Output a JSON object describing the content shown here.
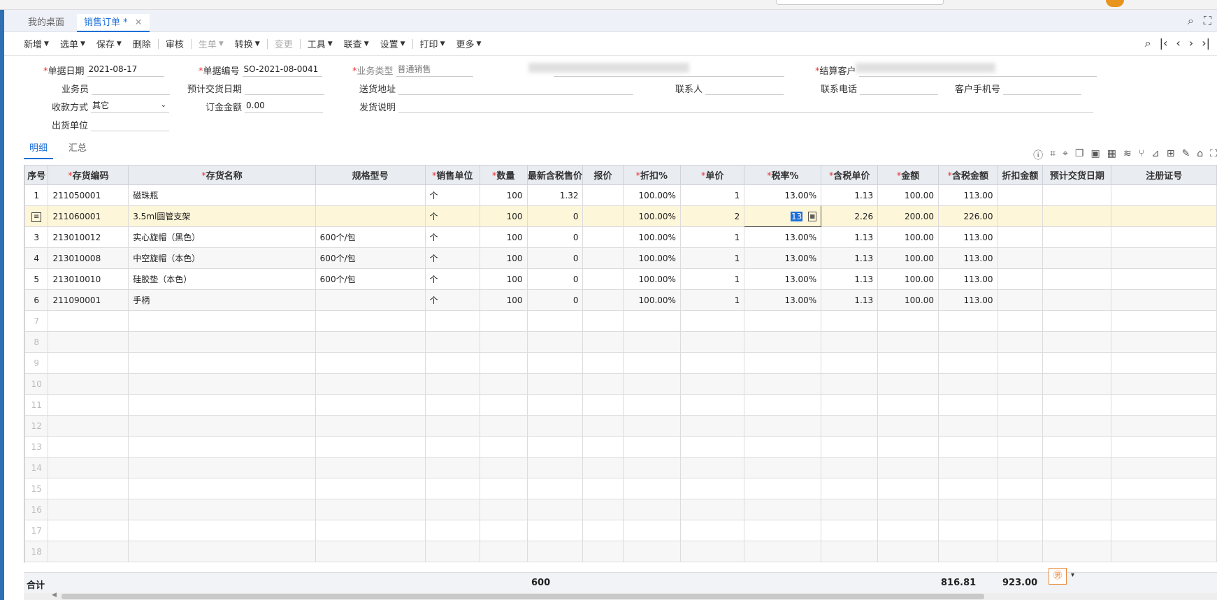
{
  "tabs": [
    {
      "label": "我的桌面",
      "active": false
    },
    {
      "label": "销售订单 *",
      "active": true
    }
  ],
  "toolbar": {
    "items": [
      "新增",
      "选单",
      "保存",
      "删除",
      "审核",
      "生单",
      "转换",
      "变更",
      "工具",
      "联查",
      "设置",
      "打印",
      "更多"
    ]
  },
  "form": {
    "doc_date_label": "单据日期",
    "doc_date": "2021-08-17",
    "doc_no_label": "单据编号",
    "doc_no": "SO-2021-08-0041",
    "biz_type_label": "业务类型",
    "biz_type": "普通销售",
    "settle_customer_label": "结算客户",
    "salesman_label": "业务员",
    "expected_date_label": "预计交货日期",
    "ship_addr_label": "送货地址",
    "contact_label": "联系人",
    "phone_label": "联系电话",
    "mobile_label": "客户手机号",
    "payment_label": "收款方式",
    "payment": "其它",
    "deposit_label": "订金金额",
    "deposit": "0.00",
    "ship_note_label": "发货说明",
    "ship_unit_label": "出货单位"
  },
  "subtabs": [
    "明细",
    "汇总"
  ],
  "grid": {
    "headers": [
      "序号",
      "存货编码",
      "存货名称",
      "规格型号",
      "销售单位",
      "数量",
      "最新含税售价",
      "报价",
      "折扣%",
      "单价",
      "税率%",
      "含税单价",
      "金额",
      "含税金额",
      "折扣金额",
      "预计交货日期",
      "注册证号"
    ],
    "required": [
      false,
      true,
      true,
      false,
      true,
      true,
      false,
      false,
      true,
      true,
      true,
      true,
      true,
      true,
      false,
      false,
      false
    ],
    "rows": [
      {
        "idx": "1",
        "code": "211050001",
        "name": "磁珠瓶",
        "spec": "",
        "unit": "个",
        "qty": "100",
        "latest": "1.32",
        "quote": "",
        "disc": "100.00%",
        "price": "1",
        "tax": "13.00%",
        "taxprice": "1.13",
        "amount": "100.00",
        "taxamount": "113.00"
      },
      {
        "idx": "",
        "code": "211060001",
        "name": "3.5ml圆管支架",
        "spec": "",
        "unit": "个",
        "qty": "100",
        "latest": "0",
        "quote": "",
        "disc": "100.00%",
        "price": "2",
        "tax": "13",
        "taxprice": "2.26",
        "amount": "200.00",
        "taxamount": "226.00"
      },
      {
        "idx": "3",
        "code": "213010012",
        "name": "实心旋帽（黑色）",
        "spec": "600个/包",
        "unit": "个",
        "qty": "100",
        "latest": "0",
        "quote": "",
        "disc": "100.00%",
        "price": "1",
        "tax": "13.00%",
        "taxprice": "1.13",
        "amount": "100.00",
        "taxamount": "113.00"
      },
      {
        "idx": "4",
        "code": "213010008",
        "name": "中空旋帽（本色）",
        "spec": "600个/包",
        "unit": "个",
        "qty": "100",
        "latest": "0",
        "quote": "",
        "disc": "100.00%",
        "price": "1",
        "tax": "13.00%",
        "taxprice": "1.13",
        "amount": "100.00",
        "taxamount": "113.00"
      },
      {
        "idx": "5",
        "code": "213010010",
        "name": "硅胶垫（本色）",
        "spec": "600个/包",
        "unit": "个",
        "qty": "100",
        "latest": "0",
        "quote": "",
        "disc": "100.00%",
        "price": "1",
        "tax": "13.00%",
        "taxprice": "1.13",
        "amount": "100.00",
        "taxamount": "113.00"
      },
      {
        "idx": "6",
        "code": "211090001",
        "name": "手柄",
        "spec": "",
        "unit": "个",
        "qty": "100",
        "latest": "0",
        "quote": "",
        "disc": "100.00%",
        "price": "1",
        "tax": "13.00%",
        "taxprice": "1.13",
        "amount": "100.00",
        "taxamount": "113.00"
      }
    ],
    "empty_rows": [
      "7",
      "8",
      "9",
      "10",
      "11",
      "12",
      "13",
      "14",
      "15",
      "16",
      "17",
      "18"
    ]
  },
  "totals": {
    "label": "合计",
    "qty": "600",
    "amount": "816.81",
    "taxamount": "923.00"
  }
}
